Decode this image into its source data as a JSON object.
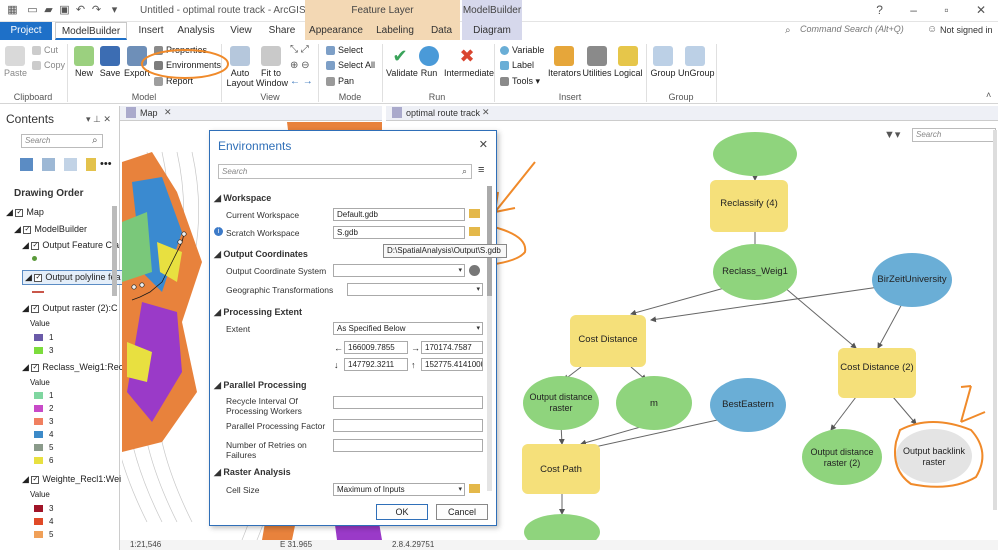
{
  "window": {
    "title": "Untitled - optimal route track - ArcGIS Pro",
    "context_feature": "Feature Layer",
    "context_mb": "ModelBuilder"
  },
  "tabs": [
    "Project",
    "ModelBuilder",
    "Insert",
    "Analysis",
    "View",
    "Share",
    "Appearance",
    "Labeling",
    "Data",
    "Diagram"
  ],
  "command_search": "Command Search (Alt+Q)",
  "signin": "Not signed in",
  "ribbon": {
    "clipboard": {
      "paste": "Paste",
      "cut": "Cut",
      "copy": "Copy",
      "group": "Clipboard"
    },
    "model": {
      "new": "New",
      "save": "Save",
      "export": "Export",
      "properties": "Properties",
      "environments": "Environments",
      "report": "Report",
      "group": "Model"
    },
    "view": {
      "auto_layout": "Auto Layout",
      "fit": "Fit to Window",
      "group": "View"
    },
    "mode": {
      "select": "Select",
      "select_all": "Select All",
      "pan": "Pan",
      "group": "Mode"
    },
    "run": {
      "validate": "Validate",
      "run": "Run",
      "intermediate": "Intermediate",
      "group": "Run"
    },
    "insert": {
      "variable": "Variable",
      "label": "Label",
      "tools": "Tools",
      "iterators": "Iterators",
      "utilities": "Utilities",
      "logical": "Logical",
      "group": "Insert"
    },
    "group": {
      "group": "Group",
      "ungroup": "UnGroup",
      "grp": "Group"
    }
  },
  "contents": {
    "title": "Contents",
    "search": "Search",
    "drawing_order": "Drawing Order",
    "items": [
      "Map",
      "ModelBuilder",
      "Output Feature Cla",
      "Output polyline fea",
      "Output raster (2):C",
      "Reclass_Weig1:Rec",
      "Weighte_Recl1:Wei"
    ],
    "value_label": "Value",
    "values_a": [
      "1",
      "3"
    ],
    "values_b": [
      "1",
      "2",
      "3",
      "4",
      "5",
      "6"
    ],
    "values_c": [
      "3",
      "4",
      "5"
    ]
  },
  "map_tab": "Map",
  "model_tab": "optimal route track",
  "model_search": "Search",
  "dialog": {
    "title": "Environments",
    "search": "Search",
    "sections": {
      "workspace": "Workspace",
      "coord": "Output Coordinates",
      "extent": "Processing Extent",
      "parallel": "Parallel Processing",
      "raster": "Raster Analysis"
    },
    "current_workspace_label": "Current Workspace",
    "current_workspace": "Default.gdb",
    "scratch_workspace_label": "Scratch Workspace",
    "scratch_workspace": "S.gdb",
    "tooltip": "D:\\SpatialAnalysis\\Output\\S.gdb",
    "ocs_label": "Output Coordinate System",
    "geo_transform_label": "Geographic Transformations",
    "extent_label": "Extent",
    "extent_value": "As Specified Below",
    "left": "166009.7855",
    "right": "170174.7587",
    "bottom": "147792.3211",
    "top": "152775.4141000",
    "recycle_label": "Recycle Interval Of Processing Workers",
    "factor_label": "Parallel Processing Factor",
    "retries_label": "Number of Retries on Failures",
    "cell_size_label": "Cell Size",
    "cell_size": "Maximum of Inputs",
    "ok": "OK",
    "cancel": "Cancel"
  },
  "model_nodes": {
    "reclassify4": "Reclassify (4)",
    "reclass_weig1": "Reclass_Weig1",
    "birzeit": "BirZeitUniversity",
    "cost_distance": "Cost Distance",
    "cost_distance2": "Cost Distance (2)",
    "out_dist": "Output distance raster",
    "m": "m",
    "besteastern": "BestEastern",
    "out_dist2": "Output distance raster (2)",
    "out_backlink": "Output backlink raster",
    "cost_path": "Cost Path"
  },
  "status": {
    "scale": "1:21,546",
    "coord": "E 31.965",
    "zoom": "2.8.4.29751"
  },
  "colors": {
    "tool": "#f5e07a",
    "data": "#8fd47d",
    "input": "#6aaed6",
    "accent": "#1e70c8",
    "annot": "#f08a2a"
  }
}
